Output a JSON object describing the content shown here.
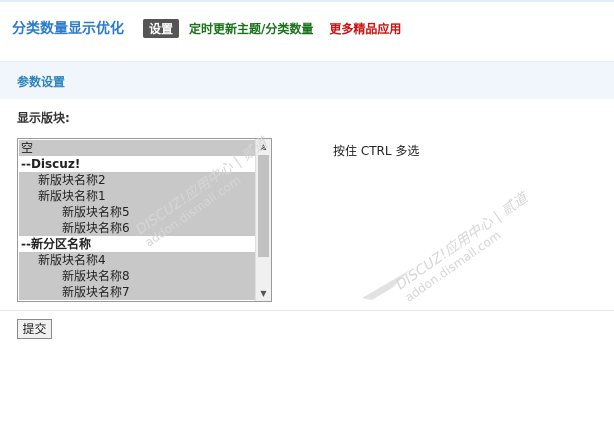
{
  "header": {
    "title": "分类数量显示优化",
    "tabs": [
      {
        "label": "设置",
        "active": true
      },
      {
        "label": "定时更新主题/分类数量",
        "active": false
      },
      {
        "label": "更多精品应用",
        "active": false
      }
    ]
  },
  "section": {
    "title": "参数设置"
  },
  "form": {
    "field_label": "显示版块:",
    "options": [
      {
        "label": "空",
        "selected": true,
        "level": 0
      },
      {
        "label": "--Discuz!",
        "selected": false,
        "group": true
      },
      {
        "label": "新版块名称2",
        "selected": true,
        "level": 1
      },
      {
        "label": "新版块名称1",
        "selected": true,
        "level": 1
      },
      {
        "label": "新版块名称5",
        "selected": true,
        "level": 2
      },
      {
        "label": "新版块名称6",
        "selected": true,
        "level": 2
      },
      {
        "label": "--新分区名称",
        "selected": false,
        "group": true
      },
      {
        "label": "新版块名称4",
        "selected": true,
        "level": 1
      },
      {
        "label": "新版块名称8",
        "selected": true,
        "level": 2
      },
      {
        "label": "新版块名称7",
        "selected": true,
        "level": 2
      }
    ],
    "hint": "按住 CTRL 多选",
    "submit_label": "提交"
  },
  "watermark": {
    "line1": "DISCUZ!应用中心 | 贰道",
    "line2": "addon.dismall.com"
  },
  "colors": {
    "title": "#2b7acd",
    "active_tab_bg": "#555555",
    "green_link": "#197219",
    "red_link": "#cc1111",
    "section_bg": "#f0f6fb",
    "selected_option_bg": "#c8c8c8"
  }
}
